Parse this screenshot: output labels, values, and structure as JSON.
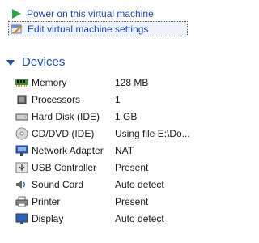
{
  "actions": {
    "power_on": "Power on this virtual machine",
    "edit_settings": "Edit virtual machine settings"
  },
  "devices_section": {
    "title": "Devices",
    "items": [
      {
        "name": "Memory",
        "value": "128 MB",
        "icon": "memory-icon"
      },
      {
        "name": "Processors",
        "value": "1",
        "icon": "processor-icon"
      },
      {
        "name": "Hard Disk (IDE)",
        "value": "1 GB",
        "icon": "hard-disk-icon"
      },
      {
        "name": "CD/DVD (IDE)",
        "value": "Using file E:\\Do...",
        "icon": "cd-dvd-icon"
      },
      {
        "name": "Network Adapter",
        "value": "NAT",
        "icon": "network-adapter-icon"
      },
      {
        "name": "USB Controller",
        "value": "Present",
        "icon": "usb-controller-icon"
      },
      {
        "name": "Sound Card",
        "value": "Auto detect",
        "icon": "sound-card-icon"
      },
      {
        "name": "Printer",
        "value": "Present",
        "icon": "printer-icon"
      },
      {
        "name": "Display",
        "value": "Auto detect",
        "icon": "display-icon"
      }
    ]
  },
  "colors": {
    "link": "#1f48a8",
    "section_title": "#1f4fa0",
    "play_green": "#2fa34a"
  }
}
